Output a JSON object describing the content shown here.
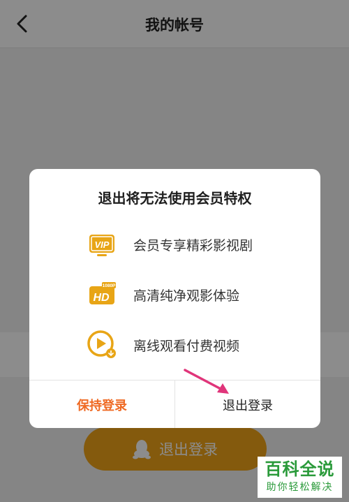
{
  "header": {
    "title": "我的帐号"
  },
  "background": {
    "logout_button_label": "退出登录"
  },
  "dialog": {
    "title": "退出将无法使用会员特权",
    "perks": [
      {
        "icon": "vip-icon",
        "label": "会员专享精彩影视剧",
        "badge": "VIP"
      },
      {
        "icon": "hd-1080p-icon",
        "label": "高清纯净观影体验",
        "badge": "HD",
        "badge_small": "1080P"
      },
      {
        "icon": "offline-play-icon",
        "label": "离线观看付费视频"
      }
    ],
    "keep_button_label": "保持登录",
    "logout_button_label": "退出登录"
  },
  "watermark": {
    "title": "百科全说",
    "subtitle": "助你轻松解决"
  },
  "colors": {
    "accent_orange": "#f0a419",
    "keep_text": "#ef6a24",
    "annotation_arrow": "#e0357a",
    "watermark_green": "#2a9a3a"
  }
}
